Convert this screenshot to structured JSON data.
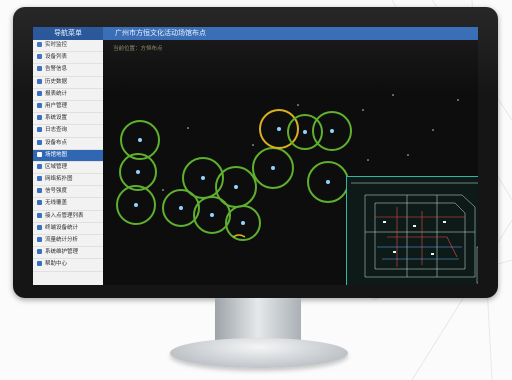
{
  "app": {
    "brand": "导航菜单",
    "title": "广州市方恒文化活动场馆布点"
  },
  "breadcrumb": "当前位置：方恒布点",
  "sidebar": {
    "items": [
      {
        "label": "实时监控",
        "icon": "monitor-icon"
      },
      {
        "label": "设备列表",
        "icon": "list-icon"
      },
      {
        "label": "告警信息",
        "icon": "alarm-icon"
      },
      {
        "label": "历史数据",
        "icon": "history-icon"
      },
      {
        "label": "报表统计",
        "icon": "report-icon"
      },
      {
        "label": "用户管理",
        "icon": "user-icon"
      },
      {
        "label": "系统设置",
        "icon": "gear-icon"
      },
      {
        "label": "日志查询",
        "icon": "log-icon"
      },
      {
        "label": "设备布点",
        "icon": "layout-icon"
      },
      {
        "label": "场馆地图",
        "icon": "map-icon",
        "active": true
      },
      {
        "label": "区域管理",
        "icon": "area-icon"
      },
      {
        "label": "网络拓扑图",
        "icon": "topology-icon"
      },
      {
        "label": "信号强度",
        "icon": "signal-icon"
      },
      {
        "label": "无线覆盖",
        "icon": "wifi-icon"
      },
      {
        "label": "接入点管理列表",
        "icon": "ap-icon"
      },
      {
        "label": "终端设备统计",
        "icon": "terminal-icon"
      },
      {
        "label": "流量统计分析",
        "icon": "traffic-icon"
      },
      {
        "label": "系统维护管理",
        "icon": "tools-icon"
      },
      {
        "label": "帮助中心",
        "icon": "help-icon"
      }
    ]
  },
  "colors": {
    "accent": "#2f67b3",
    "coverage_green": "#5fb02d",
    "coverage_yellow": "#d9b01d",
    "minimap_border": "#2fb8a0"
  }
}
